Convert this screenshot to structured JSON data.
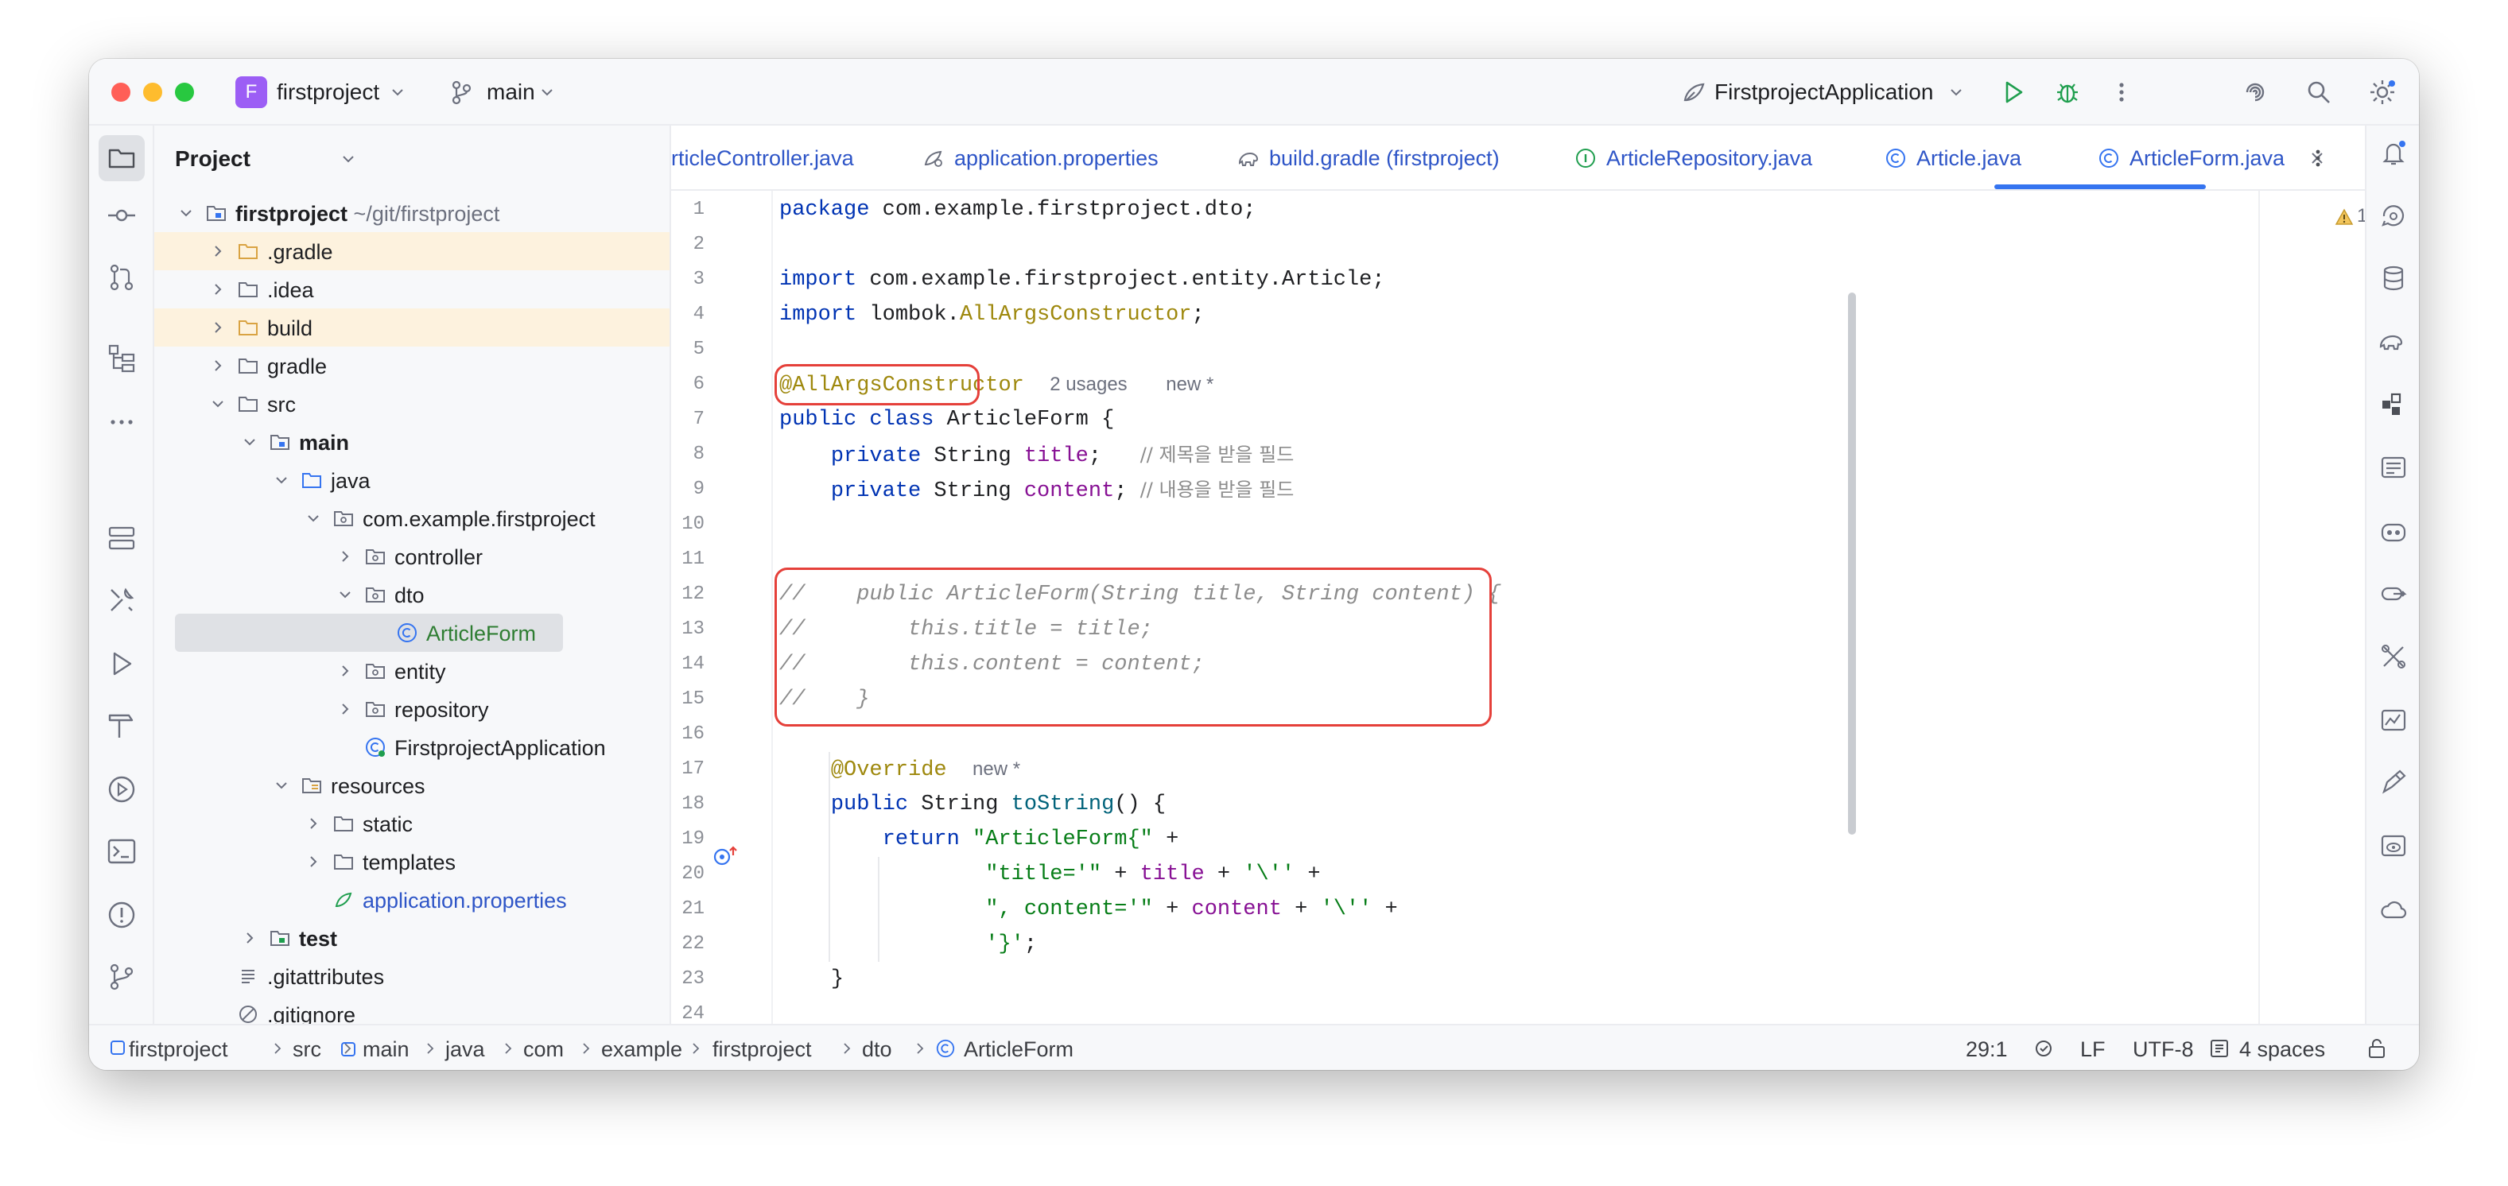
{
  "titlebar": {
    "project_badge": "F",
    "project_name": "firstproject",
    "branch": "main",
    "run_config": "FirstprojectApplication"
  },
  "project_panel": {
    "title": "Project",
    "tree": [
      {
        "label": "firstproject",
        "sub": "~/git/firstproject"
      },
      {
        "label": ".gradle"
      },
      {
        "label": ".idea"
      },
      {
        "label": "build"
      },
      {
        "label": "gradle"
      },
      {
        "label": "src"
      },
      {
        "label": "main"
      },
      {
        "label": "java"
      },
      {
        "label": "com.example.firstproject"
      },
      {
        "label": "controller"
      },
      {
        "label": "dto"
      },
      {
        "label": "ArticleForm"
      },
      {
        "label": "entity"
      },
      {
        "label": "repository"
      },
      {
        "label": "FirstprojectApplication"
      },
      {
        "label": "resources"
      },
      {
        "label": "static"
      },
      {
        "label": "templates"
      },
      {
        "label": "application.properties"
      },
      {
        "label": "test"
      },
      {
        "label": ".gitattributes"
      },
      {
        "label": ".gitignore"
      }
    ]
  },
  "tabs": [
    {
      "label": "rticleController.java"
    },
    {
      "label": "application.properties"
    },
    {
      "label": "build.gradle (firstproject)"
    },
    {
      "label": "ArticleRepository.java"
    },
    {
      "label": "Article.java"
    },
    {
      "label": "ArticleForm.java",
      "active": true
    }
  ],
  "editor": {
    "warning_count": "1",
    "line_numbers": [
      "1",
      "2",
      "3",
      "4",
      "5",
      "6",
      "7",
      "8",
      "9",
      "10",
      "11",
      "12",
      "13",
      "14",
      "15",
      "16",
      "17",
      "18",
      "19",
      "20",
      "21",
      "22",
      "23",
      "24"
    ],
    "lines": {
      "l1_kw": "package",
      "l1_rest": " com.example.firstproject.dto;",
      "l3_kw": "import",
      "l3_rest": " com.example.firstproject.entity.Article;",
      "l4_kw": "import",
      "l4_pre": " lombok.",
      "l4_ann": "AllArgsConstructor",
      "l4_post": ";",
      "l6_ann": "@AllArgsConstructor",
      "l6_hint1": "2 usages",
      "l6_hint2": "new *",
      "l7_kw": "public class",
      "l7_rest": " ArticleForm {",
      "l8_kw": "private",
      "l8_type": " String ",
      "l8_fld": "title",
      "l8_semi": ";   ",
      "l8_cmt": "// 제목을 받을 필드",
      "l9_kw": "private",
      "l9_type": " String ",
      "l9_fld": "content",
      "l9_semi": "; ",
      "l9_cmt": "// 내용을 받을 필드",
      "l12": "//    public ArticleForm(String title, String content) {",
      "l13": "//        this.title = title;",
      "l14": "//        this.content = content;",
      "l15": "//    }",
      "l17_ann": "@Override",
      "l17_hint": "new *",
      "l18_kw": "public",
      "l18_type": " String ",
      "l18_mth": "toString",
      "l18_rest": "() {",
      "l19_kw": "return",
      "l19_str": " \"ArticleForm{\"",
      "l19_rest": " +",
      "l20_str": "\"title='\"",
      "l20_p1": " + ",
      "l20_fld": "title",
      "l20_p2": " + ",
      "l20_str2": "'\\''",
      "l20_p3": " +",
      "l21_str": "\", content='\"",
      "l21_p1": " + ",
      "l21_fld": "content",
      "l21_p2": " + ",
      "l21_str2": "'\\''",
      "l21_p3": " +",
      "l22_str": "'}'",
      "l22_rest": ";",
      "l23": "}"
    }
  },
  "statusbar": {
    "breadcrumbs": [
      "firstproject",
      "src",
      "main",
      "java",
      "com",
      "example",
      "firstproject",
      "dto",
      "ArticleForm"
    ],
    "position": "29:1",
    "line_ending": "LF",
    "encoding": "UTF-8",
    "indent": "4 spaces"
  },
  "colors": {
    "accent": "#3574f0",
    "highlight_box": "#e5403a",
    "project_badge": "#9c5ef5"
  }
}
